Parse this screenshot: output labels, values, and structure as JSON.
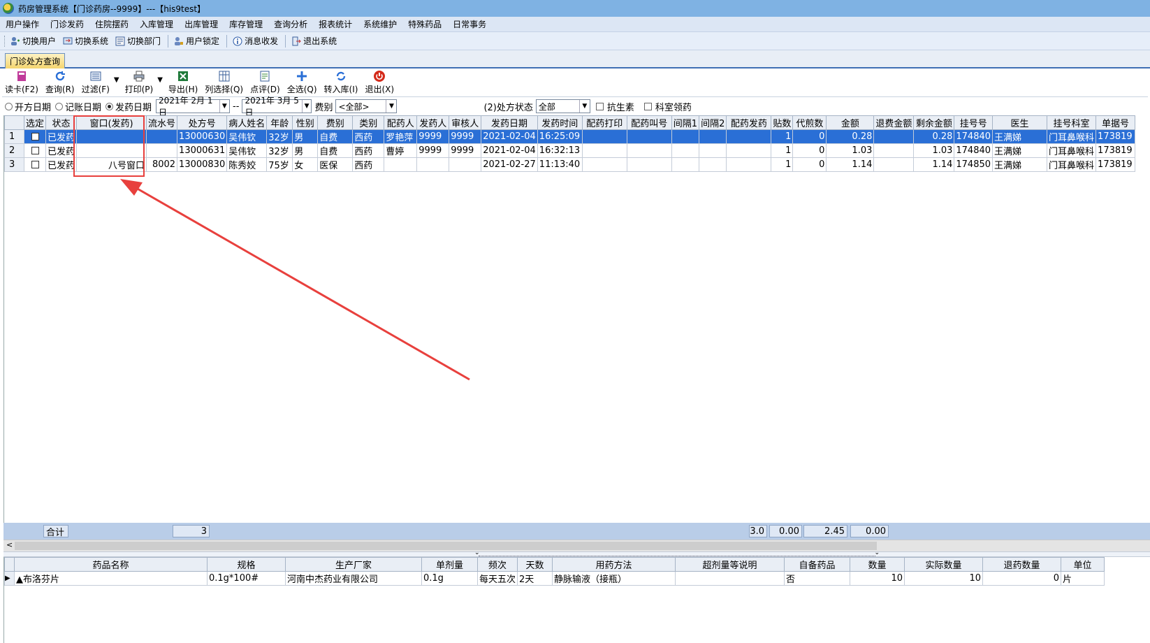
{
  "titlebar": {
    "title": "药房管理系统【门诊药房--9999】---【his9test】"
  },
  "menu": [
    "用户操作",
    "门诊发药",
    "住院摆药",
    "入库管理",
    "出库管理",
    "库存管理",
    "查询分析",
    "报表统计",
    "系统维护",
    "特殊药品",
    "日常事务"
  ],
  "toolbar": {
    "items": [
      {
        "label": "切换用户",
        "icon": "switch-user-icon"
      },
      {
        "label": "切换系统",
        "icon": "switch-system-icon"
      },
      {
        "label": "切换部门",
        "icon": "switch-department-icon"
      },
      {
        "label": "用户锁定",
        "icon": "user-lock-icon"
      },
      {
        "label": "消息收发",
        "icon": "info-message-icon"
      },
      {
        "label": "退出系统",
        "icon": "exit-system-icon"
      }
    ]
  },
  "tab": {
    "label": "门诊处方查询"
  },
  "actions": [
    {
      "label": "读卡(F2)",
      "icon": "read-card-icon"
    },
    {
      "label": "查询(R)",
      "icon": "refresh-query-icon"
    },
    {
      "label": "过滤(F)",
      "icon": "filter-icon"
    },
    {
      "label": "打印(P)",
      "icon": "printer-icon"
    },
    {
      "label": "导出(H)",
      "icon": "excel-export-icon"
    },
    {
      "label": "列选择(Q)",
      "icon": "column-select-icon"
    },
    {
      "label": "点评(D)",
      "icon": "review-icon"
    },
    {
      "label": "全选(Q)",
      "icon": "select-all-icon"
    },
    {
      "label": "转入库(I)",
      "icon": "transfer-icon"
    },
    {
      "label": "退出(X)",
      "icon": "power-exit-icon"
    }
  ],
  "filter": {
    "radio_options": [
      "开方日期",
      "记账日期",
      "发药日期"
    ],
    "radio_selected": "发药日期",
    "date_from": "2021年 2月 1日",
    "date_sep": "--",
    "date_to": "2021年 3月 5日",
    "fee_label": "费别",
    "fee_value": "<全部>",
    "status_label": "(2)处方状态",
    "status_value": "全部",
    "antibiotic_label": "抗生素",
    "dept_label": "科室领药"
  },
  "grid": {
    "columns": [
      "",
      "选定",
      "状态",
      "窗口(发药)",
      "流水号",
      "处方号",
      "病人姓名",
      "年龄",
      "性别",
      "费别",
      "类别",
      "配药人",
      "发药人",
      "审核人",
      "发药日期",
      "发药时间",
      "配药打印",
      "配药叫号",
      "间隔1",
      "间隔2",
      "配药发药",
      "贴数",
      "代煎数",
      "金额",
      "退费金额",
      "剩余金额",
      "挂号号",
      "医生",
      "挂号科室",
      "单据号"
    ],
    "rows": [
      [
        "1",
        "",
        "已发药",
        "",
        "",
        "13000630",
        "吴伟钦",
        "32岁",
        "男",
        "自费",
        "西药",
        "罗艳萍",
        "9999",
        "9999",
        "2021-02-04",
        "16:25:09",
        "",
        "",
        "",
        "",
        "",
        "1",
        "0",
        "0.28",
        "",
        "0.28",
        "174840",
        "王满娣",
        "门耳鼻喉科",
        "173819"
      ],
      [
        "2",
        "",
        "已发药",
        "",
        "",
        "13000631",
        "吴伟钦",
        "32岁",
        "男",
        "自费",
        "西药",
        "曹婷",
        "9999",
        "9999",
        "2021-02-04",
        "16:32:13",
        "",
        "",
        "",
        "",
        "",
        "1",
        "0",
        "1.03",
        "",
        "1.03",
        "174840",
        "王满娣",
        "门耳鼻喉科",
        "173819"
      ],
      [
        "3",
        "",
        "已发药",
        "八号窗口",
        "8002",
        "13000830",
        "陈秀姣",
        "75岁",
        "女",
        "医保",
        "西药",
        "",
        "",
        "",
        "2021-02-27",
        "11:13:40",
        "",
        "",
        "",
        "",
        "",
        "1",
        "0",
        "1.14",
        "",
        "1.14",
        "174850",
        "王满娣",
        "门耳鼻喉科",
        "173819"
      ]
    ],
    "selected_row": 0
  },
  "totals": {
    "label": "合计",
    "count": "3",
    "tie": "3.0",
    "decoct": "0.00",
    "amount": "2.45",
    "refund": "0.00"
  },
  "detail": {
    "columns": [
      "",
      "药品名称",
      "规格",
      "生产厂家",
      "单剂量",
      "频次",
      "天数",
      "用药方法",
      "超剂量等说明",
      "自备药品",
      "数量",
      "实际数量",
      "退药数量",
      "单位"
    ],
    "rows": [
      [
        "▶",
        "▲布洛芬片",
        "0.1g*100#",
        "河南中杰药业有限公司",
        "0.1g",
        "每天五次",
        "2天",
        "静脉输液（接瓶）",
        "",
        "否",
        "10",
        "10",
        "0",
        "片"
      ]
    ]
  },
  "colors": {
    "selection": "#2a6fd6",
    "annotation": "#e8403d",
    "titlebar": "#7fb2e3"
  }
}
